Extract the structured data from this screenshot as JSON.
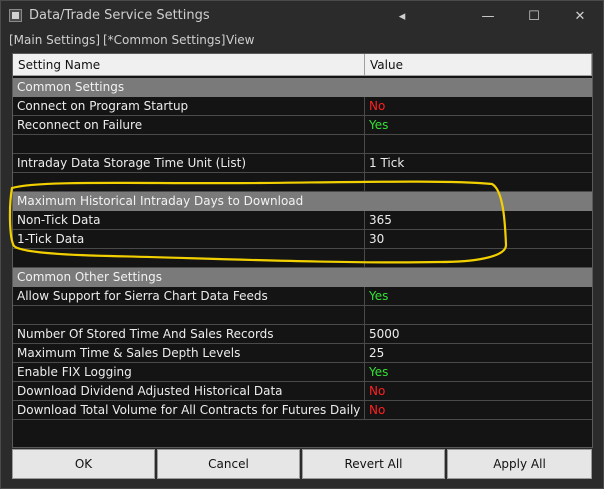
{
  "window": {
    "title": "Data/Trade Service Settings",
    "controls": {
      "back": "◂",
      "minimize": "—",
      "maximize": "☐",
      "close": "✕"
    }
  },
  "menu": [
    "[Main Settings]",
    "[*Common Settings]",
    "View"
  ],
  "grid": {
    "headers": [
      "Setting Name",
      "Value"
    ],
    "sections": [
      {
        "title": "Common Settings",
        "rows": [
          {
            "name": "Connect on Program Startup",
            "value": "No",
            "status": "red"
          },
          {
            "name": "Reconnect on Failure",
            "value": "Yes",
            "status": "green"
          },
          {
            "name": "",
            "value": ""
          },
          {
            "name": "Intraday Data Storage Time Unit (List)",
            "value": "1 Tick"
          },
          {
            "name": "",
            "value": ""
          }
        ]
      },
      {
        "title": "Maximum Historical Intraday Days to Download",
        "rows": [
          {
            "name": "Non-Tick Data",
            "value": "365"
          },
          {
            "name": "1-Tick Data",
            "value": "30"
          },
          {
            "name": "",
            "value": ""
          }
        ]
      },
      {
        "title": "Common Other Settings",
        "rows": [
          {
            "name": "Allow Support for Sierra Chart Data Feeds",
            "value": "Yes",
            "status": "green"
          },
          {
            "name": "",
            "value": ""
          },
          {
            "name": "Number Of Stored Time And Sales Records",
            "value": "5000"
          },
          {
            "name": "Maximum Time & Sales Depth Levels",
            "value": "25"
          },
          {
            "name": "Enable FIX Logging",
            "value": "Yes",
            "status": "green"
          },
          {
            "name": "Download Dividend Adjusted Historical Data",
            "value": "No",
            "status": "red"
          },
          {
            "name": "Download Total Volume for All Contracts for Futures Daily Data",
            "value": "No",
            "status": "red"
          }
        ]
      }
    ]
  },
  "buttons": {
    "ok": "OK",
    "cancel": "Cancel",
    "revert_all": "Revert All",
    "apply_all": "Apply All"
  },
  "colors": {
    "highlight": "#f2d000",
    "no": "#ff2020",
    "yes": "#35e035",
    "section": "#7a7a7a"
  }
}
